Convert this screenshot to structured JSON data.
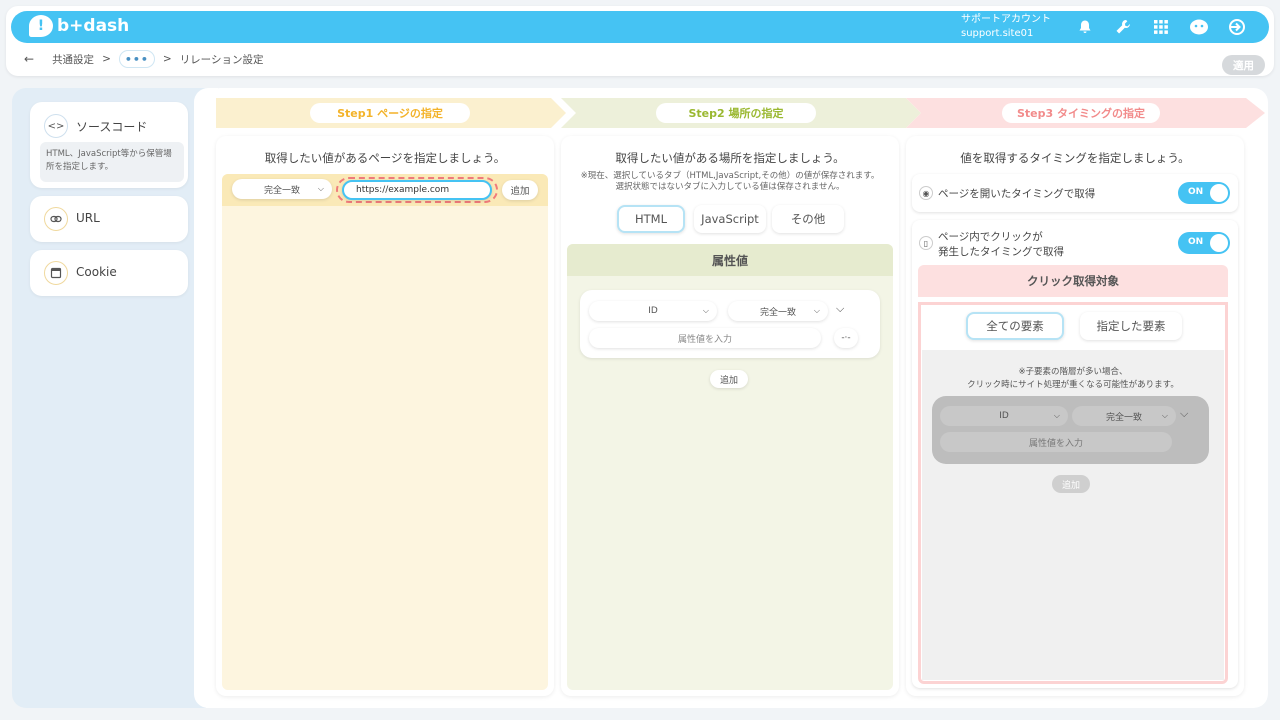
{
  "header": {
    "logo": "b+dash",
    "account_label": "サポートアカウント",
    "account_id": "support.site01",
    "icons": [
      "bell-icon",
      "wrench-icon",
      "grid-icon",
      "chat-face-icon",
      "logout-icon"
    ]
  },
  "breadcrumb": {
    "back": "←",
    "item1": "共通設定",
    "sep": ">",
    "dots": "•••",
    "item3": "リレーション設定",
    "apply": "適用"
  },
  "sidebar": {
    "items": [
      {
        "label": "ソースコード",
        "desc": "HTML、JavaScript等から保管場所を指定します。",
        "icon": "code-icon"
      },
      {
        "label": "URL",
        "icon": "link-icon"
      },
      {
        "label": "Cookie",
        "icon": "window-icon"
      }
    ]
  },
  "steps": [
    {
      "label": "Step1 ページの指定",
      "color": "#f3b32a"
    },
    {
      "label": "Step2 場所の指定",
      "color": "#9ab830"
    },
    {
      "label": "Step3 タイミングの指定",
      "color": "#f28b8b"
    }
  ],
  "step1": {
    "title": "取得したい値があるページを指定しましょう。",
    "match": "完全一致",
    "url": "https://example.com",
    "add": "追加"
  },
  "step2": {
    "title": "取得したい値がある場所を指定しましょう。",
    "note1": "※現在、選択しているタブ（HTML,JavaScript,その他）の値が保存されます。",
    "note2": "選択状態ではないタブに入力している値は保存されません。",
    "tabs": [
      "HTML",
      "JavaScript",
      "その他"
    ],
    "section": "属性値",
    "select1": "ID",
    "select2": "完全一致",
    "input_placeholder": "属性値を入力",
    "add": "追加"
  },
  "step3": {
    "title": "値を取得するタイミングを指定しましょう。",
    "timing1": "ページを開いたタイミングで取得",
    "timing2_line1": "ページ内でクリックが",
    "timing2_line2": "発生したタイミングで取得",
    "toggle_on": "ON",
    "click_target": "クリック取得対象",
    "btn_all": "全ての要素",
    "btn_specified": "指定した要素",
    "warn1": "※子要素の階層が多い場合、",
    "warn2": "クリック時にサイト処理が重くなる可能性があります。",
    "select1": "ID",
    "select2": "完全一致",
    "input_placeholder": "属性値を入力",
    "add": "追加"
  }
}
